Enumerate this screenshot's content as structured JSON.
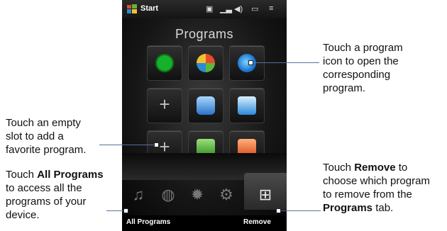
{
  "status_bar": {
    "start_label": "Start"
  },
  "screen": {
    "title": "Programs",
    "empty_slot_symbol": "+",
    "soft_keys": {
      "left": "All Programs",
      "right": "Remove"
    },
    "tiles": [
      {
        "name": "sync-icon"
      },
      {
        "name": "internet-explorer-icon"
      },
      {
        "name": "media-player-icon"
      },
      {
        "name": "empty-slot"
      },
      {
        "name": "messenger-icon"
      },
      {
        "name": "user-icon"
      },
      {
        "name": "empty-slot"
      },
      {
        "name": "excel-mobile-icon"
      },
      {
        "name": "powerpoint-mobile-icon"
      }
    ],
    "tabs": [
      "music-icon",
      "internet-icon",
      "weather-icon",
      "settings-icon",
      "programs-icon"
    ]
  },
  "callouts": {
    "open_program": [
      "Touch a program",
      "icon to open the",
      "corresponding",
      "program."
    ],
    "empty_slot": [
      "Touch an empty",
      "slot to add a",
      "favorite program."
    ],
    "all_programs": {
      "lines": [
        "Touch ",
        "All Programs",
        "to access all the",
        "programs of your",
        "device."
      ]
    },
    "remove": {
      "lines": [
        "Touch ",
        "Remove",
        " to",
        "choose which program",
        "to remove from the",
        "Programs",
        " tab."
      ]
    }
  }
}
